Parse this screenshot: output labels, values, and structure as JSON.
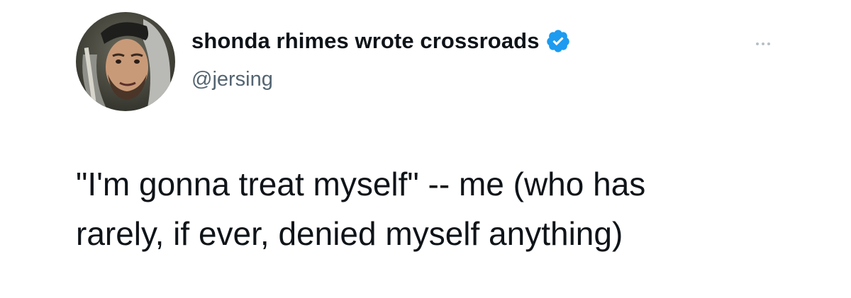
{
  "author": {
    "display_name": "shonda rhimes wrote crossroads",
    "handle": "@jersing",
    "verified": true,
    "avatar_icon": "profile-photo"
  },
  "tweet": {
    "text_lines": [
      "\"I'm gonna treat myself\" -- me (who has",
      "rarely, if ever, denied myself anything)"
    ]
  },
  "menu": {
    "more_icon": "ellipsis-icon"
  },
  "colors": {
    "text": "#0f1419",
    "handle": "#536471",
    "verified": "#1d9bf0",
    "more_dots": "#b6bfc6"
  }
}
